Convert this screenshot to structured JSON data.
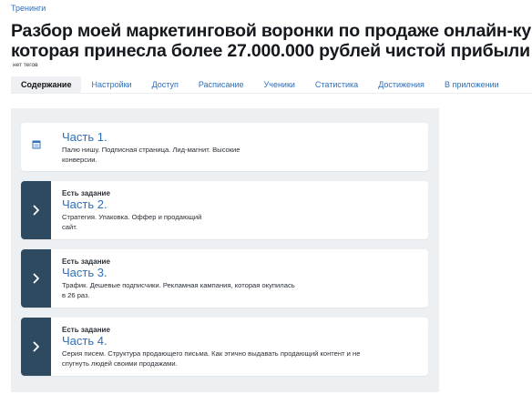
{
  "breadcrumb": "Тренинги",
  "title": {
    "line1": "Разбор моей маркетинговой воронки по продаже онлайн-курса,",
    "line2": "которая принесла более 27.000.000 рублей чистой прибыли"
  },
  "tags_text": "нет тегов",
  "tabs": [
    {
      "label": "Содержание",
      "active": true
    },
    {
      "label": "Настройки"
    },
    {
      "label": "Доступ"
    },
    {
      "label": "Расписание"
    },
    {
      "label": "Ученики"
    },
    {
      "label": "Статистика"
    },
    {
      "label": "Достижения"
    },
    {
      "label": "В приложении"
    }
  ],
  "lessons": [
    {
      "icon": "document-icon",
      "name": "Часть 1.",
      "desc_line1": "Палю нишу. Подписная страница. Лид-магнит. Высокие",
      "desc_line2": "конверсии."
    },
    {
      "icon": "chevron-right-icon",
      "task_label": "Есть задание",
      "name": "Часть 2.",
      "desc_line1": "Стратегия. Упаковка. Оффер и продающий",
      "desc_line2": "сайт."
    },
    {
      "icon": "chevron-right-icon",
      "task_label": "Есть задание",
      "name": "Часть 3.",
      "desc_line1": "Трафик. Дешевые подписчики. Рекламная кампания, которая окупилась",
      "desc_line2": "в 26 раз."
    },
    {
      "icon": "chevron-right-icon",
      "task_label": "Есть задание",
      "name": "Часть 4.",
      "desc_line1": "Серия писем. Структура продающего письма. Как этично выдавать продающий контент и не",
      "desc_line2": "спугнуть людей своими продажами."
    }
  ],
  "colors": {
    "link": "#2f6fb8",
    "side_bar": "#2e4a61",
    "panel_bg": "#ecf0f3",
    "active_tab_bg": "#eef0f3"
  }
}
